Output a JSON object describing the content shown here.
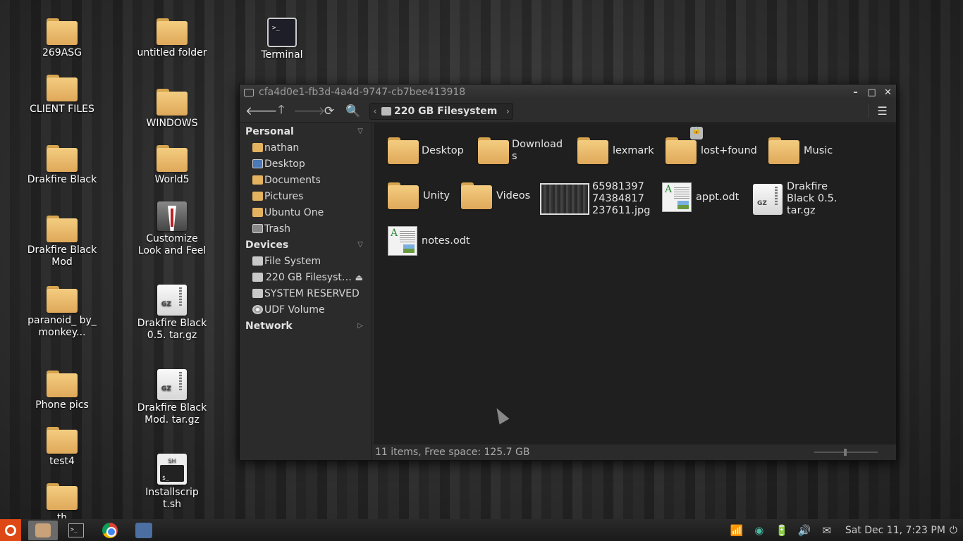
{
  "desktop": {
    "icons": [
      {
        "label": "269ASG",
        "type": "folder"
      },
      {
        "label": "CLIENT FILES",
        "type": "folder"
      },
      {
        "label": "Drakfire Black",
        "type": "folder"
      },
      {
        "label": "Drakfire Black Mod",
        "type": "folder"
      },
      {
        "label": "paranoid_ by_ monkey...",
        "type": "folder"
      },
      {
        "label": "Phone pics",
        "type": "folder"
      },
      {
        "label": "test4",
        "type": "folder"
      },
      {
        "label": "th",
        "type": "folder"
      },
      {
        "label": "untitled folder",
        "type": "folder"
      },
      {
        "label": "WINDOWS",
        "type": "folder"
      },
      {
        "label": "World5",
        "type": "folder"
      },
      {
        "label": "Customize Look and Feel",
        "type": "app"
      },
      {
        "label": "Drakfire Black 0.5. tar.gz",
        "type": "gz"
      },
      {
        "label": "Drakfire Black Mod. tar.gz",
        "type": "gz"
      },
      {
        "label": "Installscrip t.sh",
        "type": "sh"
      },
      {
        "label": "Terminal",
        "type": "terminal"
      }
    ],
    "gz_badge": "GZ",
    "sh_badge": "SH",
    "sh_prompt": "$_",
    "term_prompt": ">_"
  },
  "window": {
    "title": "cfa4d0e1-fb3d-4a4d-9747-cb7bee413918",
    "buttons": {
      "minimize": "–",
      "maximize": "□",
      "close": "✕"
    },
    "toolbar": {
      "back": "🡐",
      "up": "🡑",
      "forward": "🡒",
      "reload": "⟳",
      "search": "🔍",
      "path_left": "‹",
      "path_right": "›",
      "path_segment": "220 GB Filesystem",
      "view": "☰"
    },
    "sidebar": {
      "personal_header": "Personal",
      "personal": [
        "nathan",
        "Desktop",
        "Documents",
        "Pictures",
        "Ubuntu One",
        "Trash"
      ],
      "devices_header": "Devices",
      "devices": [
        "File System",
        "220 GB Filesyst…",
        "SYSTEM RESERVED",
        "UDF Volume"
      ],
      "eject": "⏏",
      "network_header": "Network",
      "collapse_chevron": "▽",
      "expand_chevron": "▷"
    },
    "files": [
      {
        "name": "Desktop",
        "type": "folder"
      },
      {
        "name": "Download s",
        "type": "folder"
      },
      {
        "name": "lexmark",
        "type": "folder"
      },
      {
        "name": "lost+found",
        "type": "folder"
      },
      {
        "name": "Music",
        "type": "folder"
      },
      {
        "name": "Unity",
        "type": "folder"
      },
      {
        "name": "Videos",
        "type": "folder"
      },
      {
        "name": "65981397 74384817 237611.jpg",
        "type": "image"
      },
      {
        "name": "appt.odt",
        "type": "doc"
      },
      {
        "name": "Drakfire Black 0.5. tar.gz",
        "type": "gz"
      },
      {
        "name": "notes.odt",
        "type": "doc"
      }
    ],
    "doc_glyph": "A",
    "status": "11 items, Free space: 125.7 GB"
  },
  "taskbar": {
    "clock": "Sat Dec 11,  7:23 PM",
    "term_prompt": ">_",
    "tray": {
      "signal": "📶",
      "volume": "🔊",
      "mail": "✉",
      "power": "⏻",
      "battery": "🔋"
    }
  }
}
